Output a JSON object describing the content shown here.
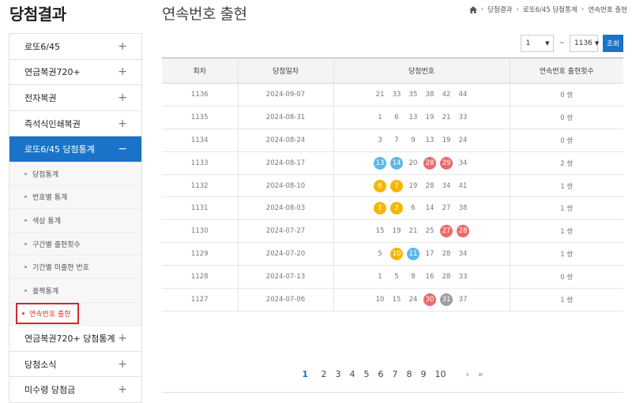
{
  "left_title": "당첨결과",
  "sidebar": {
    "top_items": [
      {
        "label": "로또6/45",
        "sign": "+"
      },
      {
        "label": "연금복권720+",
        "sign": "+"
      },
      {
        "label": "전자복권",
        "sign": "+"
      },
      {
        "label": "즉석식인쇄복권",
        "sign": "+"
      }
    ],
    "active": {
      "label": "로또6/45 당첨통계",
      "sign": "−"
    },
    "sub_items": [
      {
        "label": "당첨통계"
      },
      {
        "label": "번호별 통계"
      },
      {
        "label": "색상 통계"
      },
      {
        "label": "구간별 출현횟수"
      },
      {
        "label": "기간별 미출현 번호"
      },
      {
        "label": "홀짝통계"
      }
    ],
    "current_sub": {
      "label": "연속번호 출현"
    },
    "bottom_items": [
      {
        "label": "연금복권720+ 당첨통계",
        "sign": "+"
      },
      {
        "label": "당첨소식",
        "sign": "+"
      },
      {
        "label": "미수령 당첨금",
        "sign": "+"
      }
    ]
  },
  "header": {
    "title": "연속번호 출현",
    "breadcrumb": [
      "당첨결과",
      "로또6/45 당첨통계",
      "연속번호 출현"
    ]
  },
  "controls": {
    "from_value": "1",
    "tilde": "~",
    "to_value": "1136",
    "search_label": "조회"
  },
  "table": {
    "headers": [
      "회차",
      "당첨일자",
      "당첨번호",
      "연속번호 출현횟수"
    ],
    "rows": [
      {
        "round": "1136",
        "date": "2024-09-07",
        "count": "0 쌍",
        "numbers": [
          {
            "n": "21"
          },
          {
            "n": "33"
          },
          {
            "n": "35"
          },
          {
            "n": "38"
          },
          {
            "n": "42"
          },
          {
            "n": "44"
          }
        ]
      },
      {
        "round": "1135",
        "date": "2024-08-31",
        "count": "0 쌍",
        "numbers": [
          {
            "n": "1"
          },
          {
            "n": "6"
          },
          {
            "n": "13"
          },
          {
            "n": "19"
          },
          {
            "n": "21"
          },
          {
            "n": "33"
          }
        ]
      },
      {
        "round": "1134",
        "date": "2024-08-24",
        "count": "0 쌍",
        "numbers": [
          {
            "n": "3"
          },
          {
            "n": "7"
          },
          {
            "n": "9"
          },
          {
            "n": "13"
          },
          {
            "n": "19"
          },
          {
            "n": "24"
          }
        ]
      },
      {
        "round": "1133",
        "date": "2024-08-17",
        "count": "2 쌍",
        "numbers": [
          {
            "n": "13",
            "color": "#5bb8e6"
          },
          {
            "n": "14",
            "color": "#5bb8e6"
          },
          {
            "n": "20"
          },
          {
            "n": "28",
            "color": "#ec6a6a"
          },
          {
            "n": "29",
            "color": "#ec6a6a"
          },
          {
            "n": "34"
          }
        ]
      },
      {
        "round": "1132",
        "date": "2024-08-10",
        "count": "1 쌍",
        "numbers": [
          {
            "n": "6",
            "color": "#f6b700"
          },
          {
            "n": "7",
            "color": "#f6b700"
          },
          {
            "n": "19"
          },
          {
            "n": "28"
          },
          {
            "n": "34"
          },
          {
            "n": "41"
          }
        ]
      },
      {
        "round": "1131",
        "date": "2024-08-03",
        "count": "1 쌍",
        "numbers": [
          {
            "n": "1",
            "color": "#f6b700"
          },
          {
            "n": "2",
            "color": "#f6b700"
          },
          {
            "n": "6"
          },
          {
            "n": "14"
          },
          {
            "n": "27"
          },
          {
            "n": "38"
          }
        ]
      },
      {
        "round": "1130",
        "date": "2024-07-27",
        "count": "1 쌍",
        "numbers": [
          {
            "n": "15"
          },
          {
            "n": "19"
          },
          {
            "n": "21"
          },
          {
            "n": "25"
          },
          {
            "n": "27",
            "color": "#ec6a6a"
          },
          {
            "n": "28",
            "color": "#ec6a6a"
          }
        ]
      },
      {
        "round": "1129",
        "date": "2024-07-20",
        "count": "1 쌍",
        "numbers": [
          {
            "n": "5"
          },
          {
            "n": "10",
            "color": "#f6b700"
          },
          {
            "n": "11",
            "color": "#5bb8e6"
          },
          {
            "n": "17"
          },
          {
            "n": "28"
          },
          {
            "n": "34"
          }
        ]
      },
      {
        "round": "1128",
        "date": "2024-07-13",
        "count": "0 쌍",
        "numbers": [
          {
            "n": "1"
          },
          {
            "n": "5"
          },
          {
            "n": "8"
          },
          {
            "n": "16"
          },
          {
            "n": "28"
          },
          {
            "n": "33"
          }
        ]
      },
      {
        "round": "1127",
        "date": "2024-07-06",
        "count": "1 쌍",
        "numbers": [
          {
            "n": "10"
          },
          {
            "n": "15"
          },
          {
            "n": "24"
          },
          {
            "n": "30",
            "color": "#ec6a6a"
          },
          {
            "n": "31",
            "color": "#9e9e9e"
          },
          {
            "n": "37"
          }
        ]
      }
    ]
  },
  "pagination": {
    "current": "1",
    "pages": [
      "2",
      "3",
      "4",
      "5",
      "6",
      "7",
      "8",
      "9",
      "10"
    ],
    "next": "›",
    "last": "»"
  }
}
